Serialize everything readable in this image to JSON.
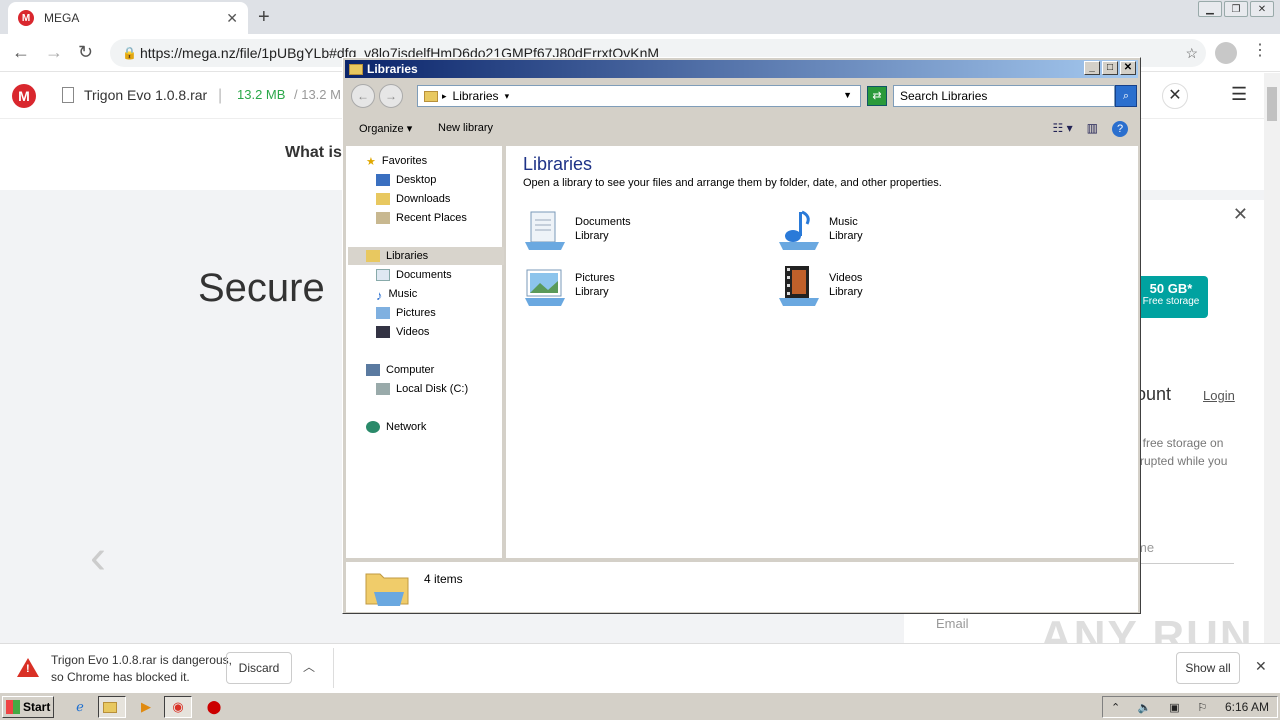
{
  "browser": {
    "tab_title": "MEGA",
    "new_tab": "+",
    "url": "https://mega.nz/file/1pUBgYLb#dfg_v8lo7isdelfHmD6do21GMPf67J80dErrxtOvKnM"
  },
  "mega": {
    "logo_letter": "M",
    "file_name": "Trigon Evo 1.0.8.rar",
    "separator": "|",
    "downloaded": "13.2 MB",
    "total": "/  13.2 M",
    "what_is": "What is",
    "hero_text": "Secure",
    "badge_size": "50 GB*",
    "badge_label": "Free storage",
    "account_heading": "ount",
    "login": "Login",
    "free_line1": "f free storage on",
    "free_line2": "rrupted while you",
    "name_placeholder": "me",
    "email_placeholder": "Email",
    "watermark": "ANY RUN"
  },
  "download_bar": {
    "line1": "Trigon Evo 1.0.8.rar is dangerous,",
    "line2": "so Chrome has blocked it.",
    "discard": "Discard",
    "show_all": "Show all"
  },
  "taskbar": {
    "start": "Start",
    "time": "6:16 AM"
  },
  "explorer": {
    "title": "Libraries",
    "address": "Libraries",
    "search_placeholder": "Search Libraries",
    "organize": "Organize",
    "new_library": "New library",
    "tree": {
      "favorites": "Favorites",
      "desktop": "Desktop",
      "downloads": "Downloads",
      "recent": "Recent Places",
      "libraries": "Libraries",
      "documents": "Documents",
      "music": "Music",
      "pictures": "Pictures",
      "videos": "Videos",
      "computer": "Computer",
      "local_disk": "Local Disk (C:)",
      "network": "Network"
    },
    "heading": "Libraries",
    "description": "Open a library to see your files and arrange them by folder, date, and other properties.",
    "libraries": [
      {
        "name": "Documents",
        "type": "Library",
        "icon": "documents-library-icon"
      },
      {
        "name": "Music",
        "type": "Library",
        "icon": "music-library-icon"
      },
      {
        "name": "Pictures",
        "type": "Library",
        "icon": "pictures-library-icon"
      },
      {
        "name": "Videos",
        "type": "Library",
        "icon": "videos-library-icon"
      }
    ],
    "status": "4 items"
  }
}
